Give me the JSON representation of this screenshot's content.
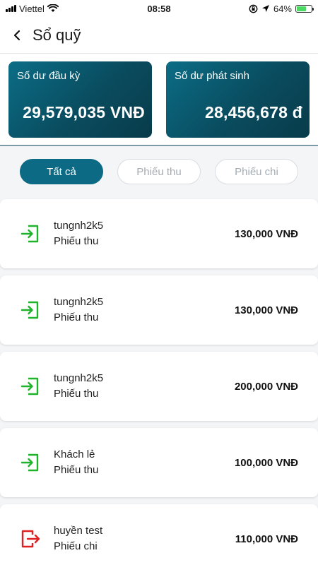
{
  "status_bar": {
    "carrier": "Viettel",
    "time": "08:58",
    "battery": "64%",
    "battery_level": 0.64
  },
  "header": {
    "title": "Sổ quỹ",
    "back_icon": "chevron-left-icon"
  },
  "summary": {
    "opening_balance": {
      "label": "Số dư đầu kỳ",
      "value": "29,579,035 VNĐ"
    },
    "incurred_balance": {
      "label": "Số dư phát sinh",
      "value": "28,456,678 đ"
    }
  },
  "tabs": [
    {
      "label": "Tất cả",
      "active": true
    },
    {
      "label": "Phiếu thu",
      "active": false
    },
    {
      "label": "Phiếu chi",
      "active": false
    }
  ],
  "transactions": [
    {
      "name": "tungnh2k5",
      "type": "Phiếu thu",
      "amount": "130,000 VNĐ",
      "icon": "receipt-in-icon",
      "color": "#1fb32b"
    },
    {
      "name": "tungnh2k5",
      "type": "Phiếu thu",
      "amount": "130,000 VNĐ",
      "icon": "receipt-in-icon",
      "color": "#1fb32b"
    },
    {
      "name": "tungnh2k5",
      "type": "Phiếu thu",
      "amount": "200,000 VNĐ",
      "icon": "receipt-in-icon",
      "color": "#1fb32b"
    },
    {
      "name": "Khách lẻ",
      "type": "Phiếu thu",
      "amount": "100,000 VNĐ",
      "icon": "receipt-in-icon",
      "color": "#1fb32b"
    },
    {
      "name": "huyền test",
      "type": "Phiếu chi",
      "amount": "110,000 VNĐ",
      "icon": "payment-out-icon",
      "color": "#e02020"
    }
  ],
  "colors": {
    "accent": "#0d6a84",
    "income": "#1fb32b",
    "expense": "#e02020"
  }
}
